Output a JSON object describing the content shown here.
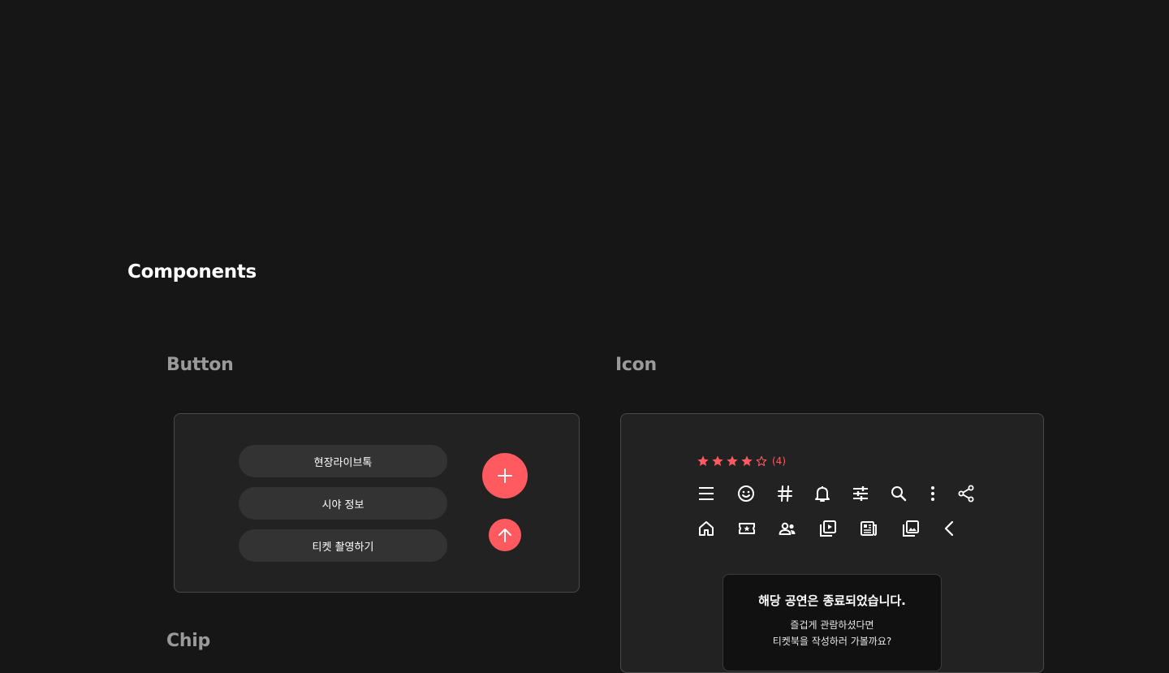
{
  "page_title": "Components",
  "sections": {
    "button": {
      "title": "Button"
    },
    "icon": {
      "title": "Icon"
    },
    "chip": {
      "title": "Chip"
    }
  },
  "buttons": {
    "pills": [
      "현장라이브톡",
      "시야 정보",
      "티켓 촬영하기"
    ],
    "fab_add_icon": "plus-icon",
    "fab_up_icon": "arrow-up-icon"
  },
  "icons": {
    "rating": {
      "value": 4,
      "max": 5,
      "count_label": "(4)"
    },
    "row1": [
      "menu-icon",
      "emoji-icon",
      "hashtag-icon",
      "bell-icon",
      "sliders-icon",
      "search-icon",
      "more-vertical-icon",
      "share-icon"
    ],
    "row2": [
      "home-icon",
      "ticket-star-icon",
      "people-icon",
      "video-library-icon",
      "news-icon",
      "photo-library-icon",
      "chevron-left-icon"
    ]
  },
  "dialog": {
    "title": "해당 공연은 종료되었습니다.",
    "line1": "즐겁게 관람하셨다면",
    "line2": "티켓북을 작성하러 가볼까요?"
  },
  "colors": {
    "background": "#161616",
    "panel": "#222222",
    "accent": "#ff5a5f",
    "pill": "#333333"
  }
}
